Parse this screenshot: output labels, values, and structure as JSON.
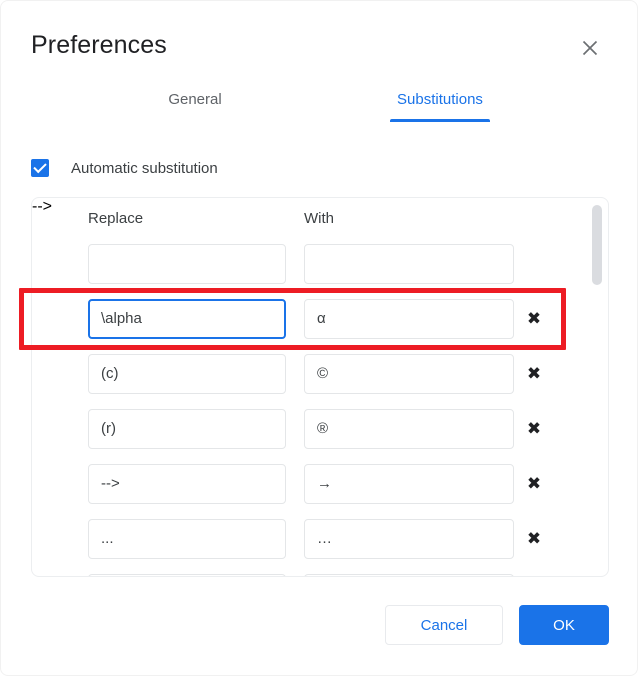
{
  "dialog": {
    "title": "Preferences",
    "close_icon": "close-icon",
    "accent_color": "#1a73e8",
    "highlight_color": "#ed1c24"
  },
  "tabs": [
    {
      "label": "General",
      "active": false
    },
    {
      "label": "Substitutions",
      "active": true
    }
  ],
  "auto_substitution": {
    "label": "Automatic substitution",
    "checked": true
  },
  "list": {
    "columns": {
      "replace": "Replace",
      "with": "With"
    },
    "new_row": {
      "replace": "",
      "with": "",
      "has_checkbox": false,
      "has_delete": false
    },
    "rows": [
      {
        "checked": true,
        "replace": "\\alpha",
        "with": "α",
        "focused": true,
        "highlighted": true,
        "delete_label": "✖"
      },
      {
        "checked": true,
        "replace": "(c)",
        "with": "©",
        "focused": false,
        "highlighted": false,
        "delete_label": "✖"
      },
      {
        "checked": true,
        "replace": "(r)",
        "with": "®",
        "focused": false,
        "highlighted": false,
        "delete_label": "✖"
      },
      {
        "checked": true,
        "replace": "-->",
        "with": "→",
        "focused": false,
        "highlighted": false,
        "delete_label": "✖"
      },
      {
        "checked": true,
        "replace": "...",
        "with": "…",
        "focused": false,
        "highlighted": false,
        "delete_label": "✖"
      }
    ],
    "scrollbar": {
      "position": "top",
      "thumb_color": "#dadce0"
    }
  },
  "footer": {
    "cancel_label": "Cancel",
    "ok_label": "OK"
  }
}
